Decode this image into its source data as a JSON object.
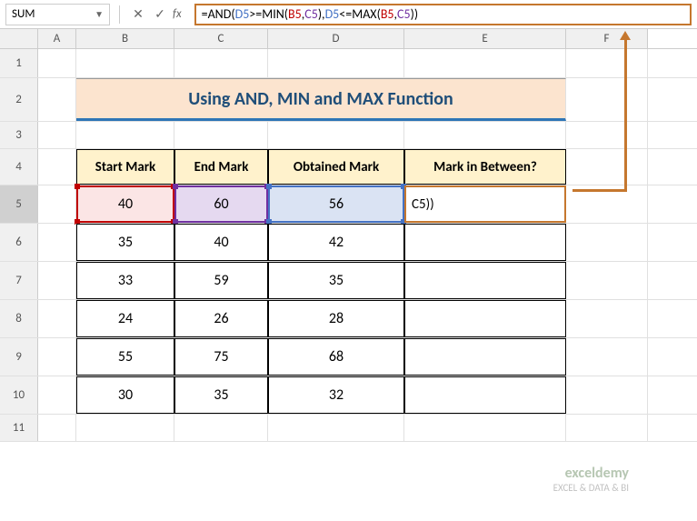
{
  "nameBox": "SUM",
  "formula": {
    "raw": "=AND(D5>=MIN(B5,C5),D5<=MAX(B5,C5))",
    "parts": [
      {
        "t": "=AND(",
        "c": "eq"
      },
      {
        "t": "D5",
        "c": "ref-d"
      },
      {
        "t": ">=MIN(",
        "c": "fn"
      },
      {
        "t": "B5",
        "c": "ref-b"
      },
      {
        "t": ",",
        "c": "fn"
      },
      {
        "t": "C5",
        "c": "ref-c"
      },
      {
        "t": "),",
        "c": "fn"
      },
      {
        "t": "D5",
        "c": "ref-d"
      },
      {
        "t": "<=MAX(",
        "c": "fn"
      },
      {
        "t": "B5",
        "c": "ref-b"
      },
      {
        "t": ",",
        "c": "fn"
      },
      {
        "t": "C5",
        "c": "ref-c"
      },
      {
        "t": "))",
        "c": "fn"
      }
    ]
  },
  "columns": [
    "A",
    "B",
    "C",
    "D",
    "E",
    "F"
  ],
  "rows": [
    "1",
    "2",
    "3",
    "4",
    "5",
    "6",
    "7",
    "8",
    "9",
    "10",
    "11"
  ],
  "title": "Using AND, MIN and MAX Function",
  "headers": {
    "b": "Start Mark",
    "c": "End Mark",
    "d": "Obtained Mark",
    "e": "Mark in Between?"
  },
  "editCellDisplay": "C5))",
  "chart_data": {
    "type": "table",
    "columns": [
      "Start Mark",
      "End Mark",
      "Obtained Mark",
      "Mark in Between?"
    ],
    "rows": [
      {
        "start": 40,
        "end": 60,
        "obtained": 56,
        "between": ""
      },
      {
        "start": 35,
        "end": 40,
        "obtained": 42,
        "between": ""
      },
      {
        "start": 33,
        "end": 59,
        "obtained": 35,
        "between": ""
      },
      {
        "start": 24,
        "end": 26,
        "obtained": 28,
        "between": ""
      },
      {
        "start": 55,
        "end": 75,
        "obtained": 68,
        "between": ""
      },
      {
        "start": 30,
        "end": 35,
        "obtained": 32,
        "between": ""
      }
    ]
  },
  "watermark": {
    "brand": "exceldemy",
    "tag": "EXCEL & DATA & BI"
  }
}
